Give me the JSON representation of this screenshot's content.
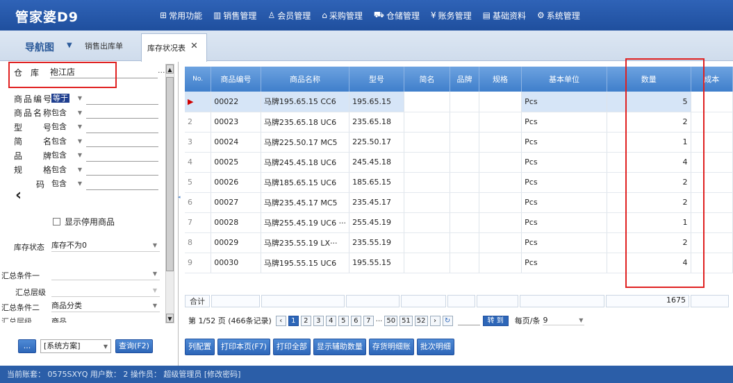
{
  "app": {
    "logo": "管家婆D9"
  },
  "menu": [
    {
      "icon": "grid-icon",
      "glyph": "⊞",
      "label": "常用功能"
    },
    {
      "icon": "chart-icon",
      "glyph": "▥",
      "label": "销售管理"
    },
    {
      "icon": "user-icon",
      "glyph": "♙",
      "label": "会员管理"
    },
    {
      "icon": "home-icon",
      "glyph": "⌂",
      "label": "采购管理"
    },
    {
      "icon": "cart-icon",
      "glyph": "⛟",
      "label": "仓储管理"
    },
    {
      "icon": "yen-icon",
      "glyph": "¥",
      "label": "账务管理"
    },
    {
      "icon": "doc-icon",
      "glyph": "▤",
      "label": "基础资料"
    },
    {
      "icon": "gear-icon",
      "glyph": "⚙",
      "label": "系统管理"
    }
  ],
  "tabs": {
    "nav": "导航图",
    "tab1": "销售出库单",
    "active": "库存状况表",
    "close": "✕"
  },
  "filters": {
    "warehouse_label": "仓　库",
    "warehouse_value": "袍江店",
    "rows": [
      {
        "label": "商品编号",
        "op": "等于"
      },
      {
        "label": "商品名称",
        "op": "包含"
      },
      {
        "label": "型　　号",
        "op": "包含"
      },
      {
        "label": "简　　名",
        "op": "包含"
      },
      {
        "label": "品　　牌",
        "op": "包含"
      },
      {
        "label": "规　　格",
        "op": "包含"
      },
      {
        "label": "码",
        "op": "包含"
      }
    ],
    "show_disabled": "显示停用商品",
    "stock_state_label": "库存状态",
    "stock_state_value": "库存不为0",
    "sum1_label": "汇总条件一",
    "level1_label": "汇总层级",
    "sum2_label": "汇总条件二",
    "sum2_value": "商品分类",
    "level2_label": "汇总层级",
    "level2_value": "商品",
    "scheme_btn": "...",
    "scheme_value": "[系统方案]",
    "query_btn": "查询(F2)"
  },
  "grid": {
    "headers": [
      "No.",
      "商品编号",
      "商品名称",
      "型号",
      "简名",
      "品牌",
      "规格",
      "基本单位",
      "数量",
      "成本"
    ],
    "rows": [
      {
        "no": "▶",
        "code": "00022",
        "name": "马牌195.65.15 CC6",
        "model": "195.65.15",
        "unit": "Pcs",
        "qty": "5"
      },
      {
        "no": "2",
        "code": "00023",
        "name": "马牌235.65.18  UC6",
        "model": "235.65.18",
        "unit": "Pcs",
        "qty": "2"
      },
      {
        "no": "3",
        "code": "00024",
        "name": "马牌225.50.17  MC5",
        "model": "225.50.17",
        "unit": "Pcs",
        "qty": "1"
      },
      {
        "no": "4",
        "code": "00025",
        "name": "马牌245.45.18 UC6",
        "model": "245.45.18",
        "unit": "Pcs",
        "qty": "4"
      },
      {
        "no": "5",
        "code": "00026",
        "name": "马牌185.65.15  UC6",
        "model": "185.65.15",
        "unit": "Pcs",
        "qty": "2"
      },
      {
        "no": "6",
        "code": "00027",
        "name": "马牌235.45.17  MC5",
        "model": "235.45.17",
        "unit": "Pcs",
        "qty": "2"
      },
      {
        "no": "7",
        "code": "00028",
        "name": "马牌255.45.19 UC6  ···",
        "model": "255.45.19",
        "unit": "Pcs",
        "qty": "1"
      },
      {
        "no": "8",
        "code": "00029",
        "name": "马牌235.55.19  LX···",
        "model": "235.55.19",
        "unit": "Pcs",
        "qty": "2"
      },
      {
        "no": "9",
        "code": "00030",
        "name": "马牌195.55.15  UC6",
        "model": "195.55.15",
        "unit": "Pcs",
        "qty": "4"
      }
    ],
    "sum_label": "合计",
    "sum_qty": "1675"
  },
  "pager": {
    "info": "第 1/52 页 (466条记录)",
    "pages": [
      "1",
      "2",
      "3",
      "4",
      "5",
      "6",
      "7",
      "...",
      "50",
      "51",
      "52"
    ],
    "goto": "转 到",
    "per_page_label": "每页/条",
    "per_page_value": "9"
  },
  "actions": [
    "列配置",
    "打印本页(F7)",
    "打印全部",
    "显示辅助数量",
    "存货明细账",
    "批次明细"
  ],
  "status": {
    "text": "当前账套： 0575SXYQ   用户数： 2     操作员： 超级管理员 [修改密码]"
  }
}
